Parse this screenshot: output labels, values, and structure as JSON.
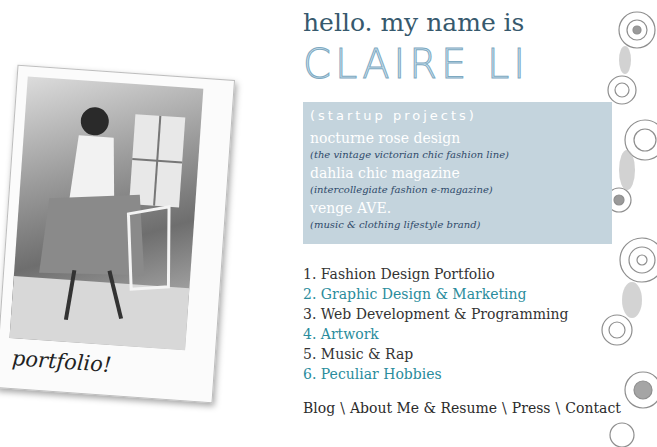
{
  "header": {
    "greeting": "hello. my name is",
    "name": "CLAIRE LI"
  },
  "photo": {
    "caption": "portfolio!"
  },
  "startup": {
    "heading": "(startup projects)",
    "projects": [
      {
        "title": "nocturne rose design",
        "description": "(the vintage victorian chic fashion line)"
      },
      {
        "title": "dahlia chic magazine",
        "description": "(intercollegiate fashion e-magazine)"
      },
      {
        "title": "venge AVE.",
        "description": "(music & clothing lifestyle brand)"
      }
    ]
  },
  "portfolio": [
    {
      "label": "1. Fashion Design Portfolio",
      "color": "#333333"
    },
    {
      "label": "2. Graphic Design & Marketing",
      "color": "#2a8c9c"
    },
    {
      "label": "3. Web Development & Programming",
      "color": "#333333"
    },
    {
      "label": "4. Artwork",
      "color": "#2a8c9c"
    },
    {
      "label": "5. Music & Rap",
      "color": "#333333"
    },
    {
      "label": "6. Peculiar Hobbies",
      "color": "#2a8c9c"
    }
  ],
  "footer": {
    "separator": "\\",
    "links": [
      "Blog",
      "About Me & Resume",
      "Press",
      "Contact"
    ]
  }
}
